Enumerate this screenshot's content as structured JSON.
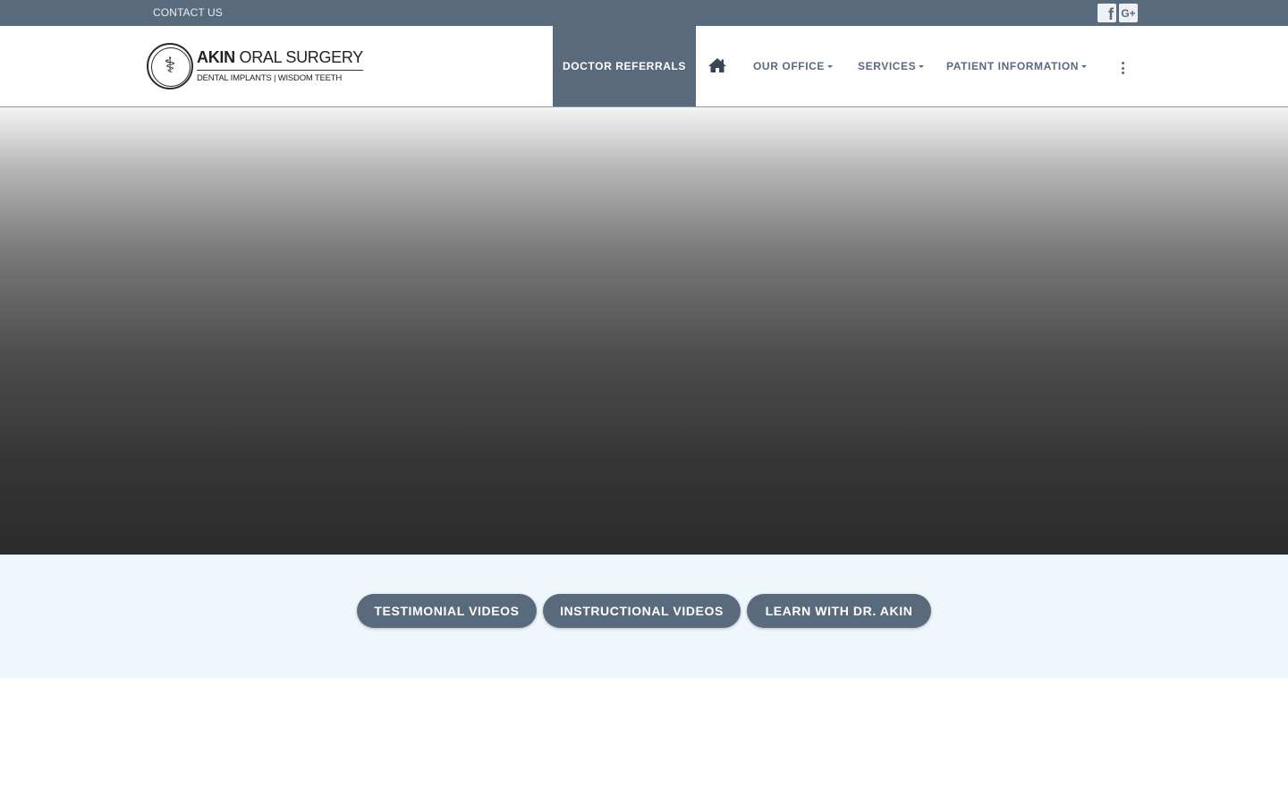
{
  "topbar": {
    "contact_label": "CONTACT US",
    "social": [
      {
        "name": "facebook",
        "glyph": "f"
      },
      {
        "name": "google-plus",
        "glyph": "G+"
      }
    ]
  },
  "logo": {
    "title_bold": "AKIN",
    "title_rest": " ORAL SURGERY",
    "subtitle": "DENTAL IMPLANTS | WISDOM TEETH",
    "emblem": "⚕"
  },
  "nav": {
    "referrals": "DOCTOR REFERRALS",
    "home_icon": "home-icon",
    "our_office": "OUR OFFICE",
    "services": "SERVICES",
    "patient_info": "PATIENT INFORMATION",
    "more_icon": "more-vertical-icon"
  },
  "videos": {
    "buttons": [
      "TESTIMONIAL VIDEOS",
      "INSTRUCTIONAL VIDEOS",
      "LEARN WITH DR. AKIN"
    ]
  },
  "colors": {
    "brand": "#5a6a7d",
    "band_bg": "#eff6fc",
    "hero_top": "#f4f4f4",
    "hero_bottom": "#2b2b2b"
  }
}
